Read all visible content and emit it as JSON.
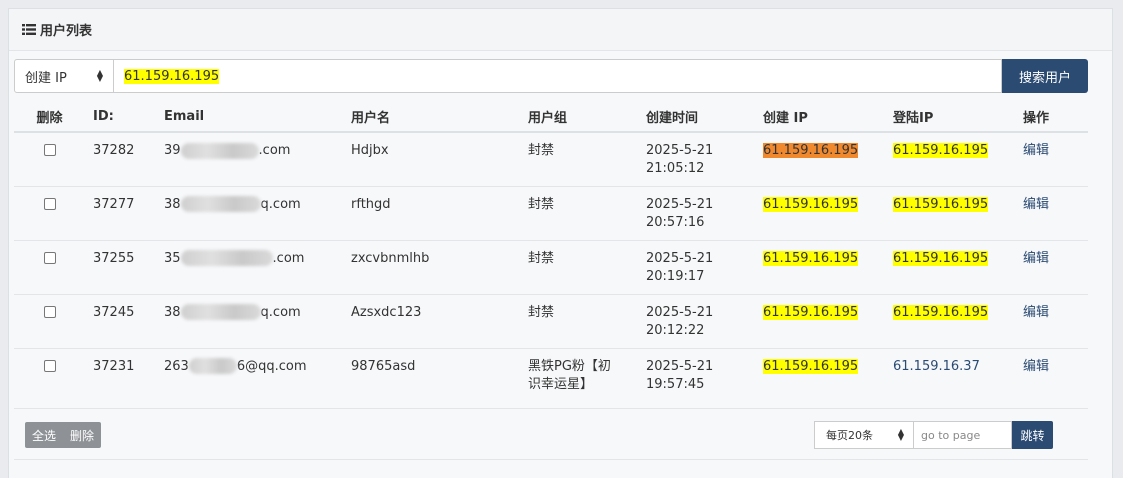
{
  "panel": {
    "title": "用户列表"
  },
  "search": {
    "field_select": "创建 IP",
    "query": "61.159.16.195",
    "button": "搜索用户"
  },
  "table": {
    "headers": {
      "del": "删除",
      "id": "ID:",
      "email": "Email",
      "name": "用户名",
      "group": "用户组",
      "time": "创建时间",
      "cip": "创建 IP",
      "lip": "登陆IP",
      "op": "操作"
    },
    "rows": [
      {
        "id": "37282",
        "email_pre": "39",
        "email_post": ".com",
        "name": "Hdjbx",
        "group": "封禁",
        "date": "2025-5-21",
        "time": "21:05:12",
        "cip": "61.159.16.195",
        "lip": "61.159.16.195",
        "op": "编辑"
      },
      {
        "id": "37277",
        "email_pre": "38",
        "email_post": "q.com",
        "name": "rfthgd",
        "group": "封禁",
        "date": "2025-5-21",
        "time": "20:57:16",
        "cip": "61.159.16.195",
        "lip": "61.159.16.195",
        "op": "编辑"
      },
      {
        "id": "37255",
        "email_pre": "35",
        "email_post": ".com",
        "name": "zxcvbnmlhb",
        "group": "封禁",
        "date": "2025-5-21",
        "time": "20:19:17",
        "cip": "61.159.16.195",
        "lip": "61.159.16.195",
        "op": "编辑"
      },
      {
        "id": "37245",
        "email_pre": "38",
        "email_post": "q.com",
        "name": "Azsxdc123",
        "group": "封禁",
        "date": "2025-5-21",
        "time": "20:12:22",
        "cip": "61.159.16.195",
        "lip": "61.159.16.195",
        "op": "编辑"
      },
      {
        "id": "37231",
        "email_pre": "263",
        "email_post": "6@qq.com",
        "name": "98765asd",
        "group_line1": "黑铁PG粉【初",
        "group_line2": "识幸运星】",
        "date": "2025-5-21",
        "time": "19:57:45",
        "cip": "61.159.16.195",
        "lip": "61.159.16.37",
        "op": "编辑"
      }
    ]
  },
  "footer": {
    "select_all": "全选",
    "delete": "删除",
    "per_page": "每页20条",
    "goto_placeholder": "go to page",
    "jump": "跳转"
  },
  "colors": {
    "primary": "#2b4b73",
    "highlight": "#ffff00",
    "highlight_orange": "#f0892e"
  }
}
